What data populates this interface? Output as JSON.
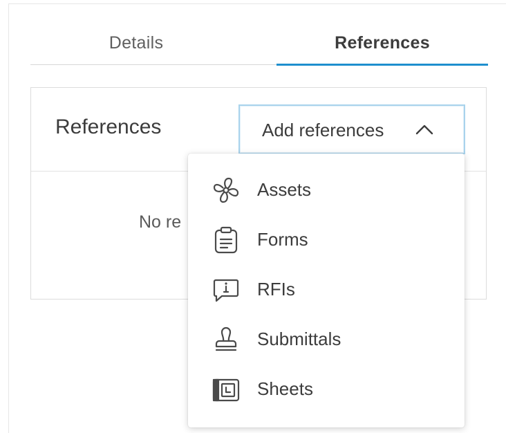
{
  "tabs": [
    {
      "label": "Details",
      "active": false
    },
    {
      "label": "References",
      "active": true
    }
  ],
  "colors": {
    "accent": "#1e8fce",
    "text": "#3c3c3c",
    "border": "#dcdcdc"
  },
  "card": {
    "title": "References",
    "add_button_label": "Add references",
    "empty_text": "No re"
  },
  "menu": {
    "items": [
      {
        "label": "Assets",
        "icon": "fan-icon"
      },
      {
        "label": "Forms",
        "icon": "clipboard-icon"
      },
      {
        "label": "RFIs",
        "icon": "info-speech-bubble-icon"
      },
      {
        "label": "Submittals",
        "icon": "stamp-icon"
      },
      {
        "label": "Sheets",
        "icon": "sheet-icon"
      }
    ]
  }
}
